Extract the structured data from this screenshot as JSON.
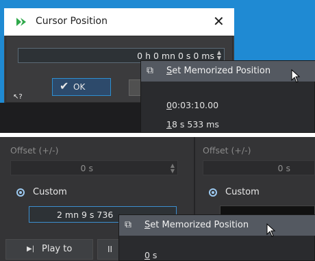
{
  "top": {
    "dialog": {
      "title": "Cursor Position",
      "close_glyph": "✕",
      "time_value": "0 h  0 mn  0 s  0 ms",
      "ok_label": "OK",
      "ok_glyph": "✔",
      "help_glyph": "↖?"
    },
    "popup": {
      "header_label": "Set Memorized Position",
      "items": [
        "00:03:10.00",
        "18 s 533 ms"
      ]
    }
  },
  "bottom": {
    "left": {
      "offset_label": "Offset (+/-)",
      "offset_value": "0 s",
      "custom_label": "Custom",
      "custom_value": "2 mn  9 s 736",
      "play_label": "Play to",
      "play_glyph": "▶|",
      "play2_glyph": "II"
    },
    "right": {
      "offset_label": "Offset (+/-)",
      "offset_value": "0 s",
      "custom_label": "Custom"
    },
    "popup": {
      "header_label": "Set Memorized Position",
      "items": [
        "0 s"
      ]
    }
  },
  "icons": {
    "app_logo": "app-logo-icon",
    "memorize": "memorize-position-icon",
    "mouse_cursor": "mouse-pointer-icon",
    "spin": "spin-arrows-icon",
    "radio": "radio-selected-icon"
  },
  "colors": {
    "desktop_blue": "#1f8ad3",
    "dark_bg": "#343436",
    "menu_hover": "#545961",
    "accent": "#3c8fd0",
    "logo_green": "#2ea84a"
  }
}
